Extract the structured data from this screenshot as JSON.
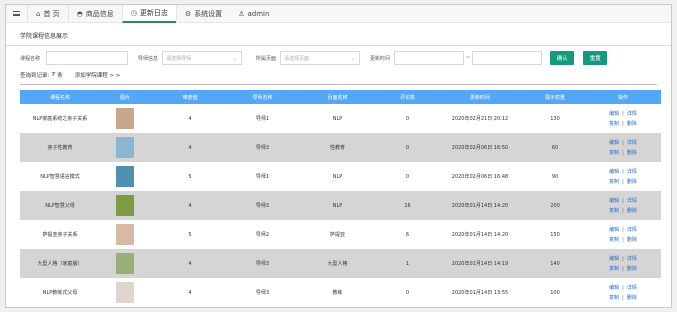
{
  "tabs": [
    {
      "icon": "⌂",
      "label": "首 页"
    },
    {
      "icon": "◓",
      "label": "商品信息"
    },
    {
      "icon": "◷",
      "label": "更新日志"
    },
    {
      "icon": "⚙",
      "label": "系统设置"
    },
    {
      "icon": "♙",
      "label": "admin"
    }
  ],
  "page": {
    "section_title": "学院课程信息展示"
  },
  "search": {
    "name_label": "课程名称",
    "guide_label": "导师信息",
    "guide_placeholder": "请选择导师",
    "page_label": "所属页面",
    "page_placeholder": "请选择页面",
    "time_label": "更新时间",
    "range_sep": "~",
    "confirm_label": "确认",
    "reset_label": "重置"
  },
  "summary": {
    "prefix": "查询到记录:",
    "count": "7",
    "suffix": "条",
    "add_link": "添加学院课程 > >"
  },
  "table": {
    "headers": [
      "课程名称",
      "图片",
      "难度值",
      "导师名称",
      "页面名称",
      "评论数",
      "更新时间",
      "展示权重",
      "操作"
    ],
    "rows": [
      {
        "name": "NLP家庭系统之亲子关系",
        "difficulty": "4",
        "guide": "导师1",
        "page": "NLP",
        "comments": "0",
        "time": "2020年02月21日 20:12",
        "weight": "130"
      },
      {
        "name": "亲子性教育",
        "difficulty": "4",
        "guide": "导师3",
        "page": "性教育",
        "comments": "0",
        "time": "2020年02月06日 16:50",
        "weight": "60"
      },
      {
        "name": "NLP智慧语言模式",
        "difficulty": "5",
        "guide": "导师1",
        "page": "NLP",
        "comments": "0",
        "time": "2020年02月06日 16:48",
        "weight": "90"
      },
      {
        "name": "NLP智慧父母",
        "difficulty": "4",
        "guide": "导师3",
        "page": "NLP",
        "comments": "16",
        "time": "2020年01月14日 14:20",
        "weight": "200"
      },
      {
        "name": "萨提亚亲子关系",
        "difficulty": "5",
        "guide": "导师2",
        "page": "萨提亚",
        "comments": "6",
        "time": "2020年01月14日 14:20",
        "weight": "150"
      },
      {
        "name": "九型人格（家庭版）",
        "difficulty": "4",
        "guide": "导师3",
        "page": "九型人格",
        "comments": "1",
        "time": "2020年01月14日 14:19",
        "weight": "140"
      },
      {
        "name": "NLP教练式父母",
        "difficulty": "4",
        "guide": "导师3",
        "page": "教练",
        "comments": "0",
        "time": "2020年01月14日 13:55",
        "weight": "100"
      }
    ],
    "ops": {
      "edit": "编辑",
      "detail": "详情",
      "copy": "复制",
      "delete": "删除",
      "sep": "|"
    }
  },
  "colors": {
    "header_blue": "#54a7f4",
    "button_green": "#159a7f",
    "count_red": "#e53935",
    "link_blue": "#2b6cc4"
  },
  "thumbs": [
    "#c9a78f",
    "#8ab5d3",
    "#4f8fb0",
    "#7f9a43",
    "#d8b9a5",
    "#9aae7a",
    "#e0d6cf"
  ]
}
